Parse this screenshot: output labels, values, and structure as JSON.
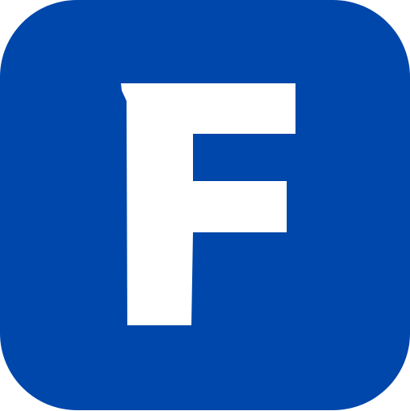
{
  "app_icon": {
    "name": "app-icon",
    "glyph": "F",
    "background_color": "#0047AB",
    "glyph_color": "#FFFFFF",
    "icon": "letter-f-logo-icon"
  }
}
